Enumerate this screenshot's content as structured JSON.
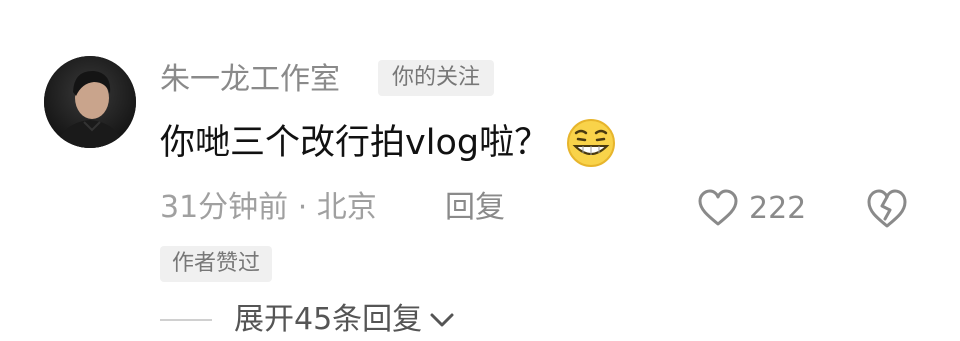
{
  "comment": {
    "author": "朱一龙工作室",
    "follow_badge": "你的关注",
    "text": "你哋三个改行拍vlog啦？",
    "emoji": "grinning-squinting-emoji",
    "time_location": "31分钟前 · 北京",
    "reply_label": "回复",
    "like_count": "222",
    "author_liked_badge": "作者赞过",
    "expand_replies": "展开45条回复"
  },
  "icons": {
    "like": "heart-outline-icon",
    "dislike": "broken-heart-icon",
    "expand": "chevron-down-icon"
  },
  "colors": {
    "muted_text": "#8a8a8a",
    "badge_bg": "#f0f0f0",
    "body_text": "#111111"
  }
}
